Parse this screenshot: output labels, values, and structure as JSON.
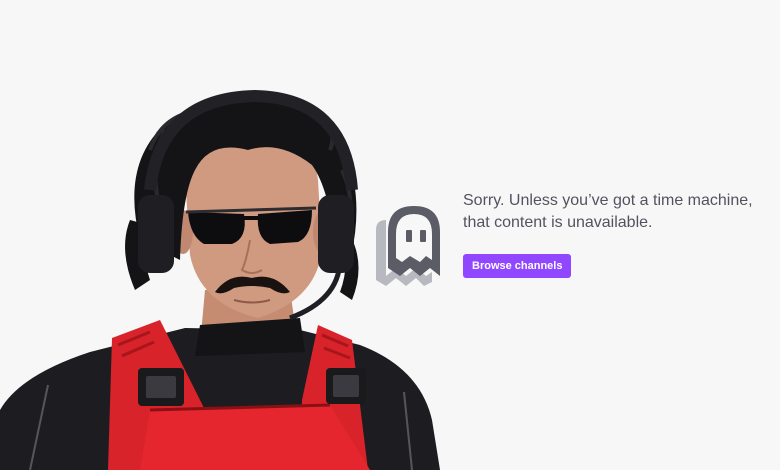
{
  "error": {
    "message": "Sorry. Unless you’ve got a time machine, that content is unavailable.",
    "button_label": "Browse channels"
  },
  "illustration": {
    "ghost_icon": "ghost-icon",
    "person_image": "streamer-photo"
  },
  "colors": {
    "background": "#f7f7f8",
    "accent": "#9147ff",
    "text": "#53535f",
    "ghost_front": "#5c5c66",
    "ghost_back": "#b8b8c0"
  }
}
